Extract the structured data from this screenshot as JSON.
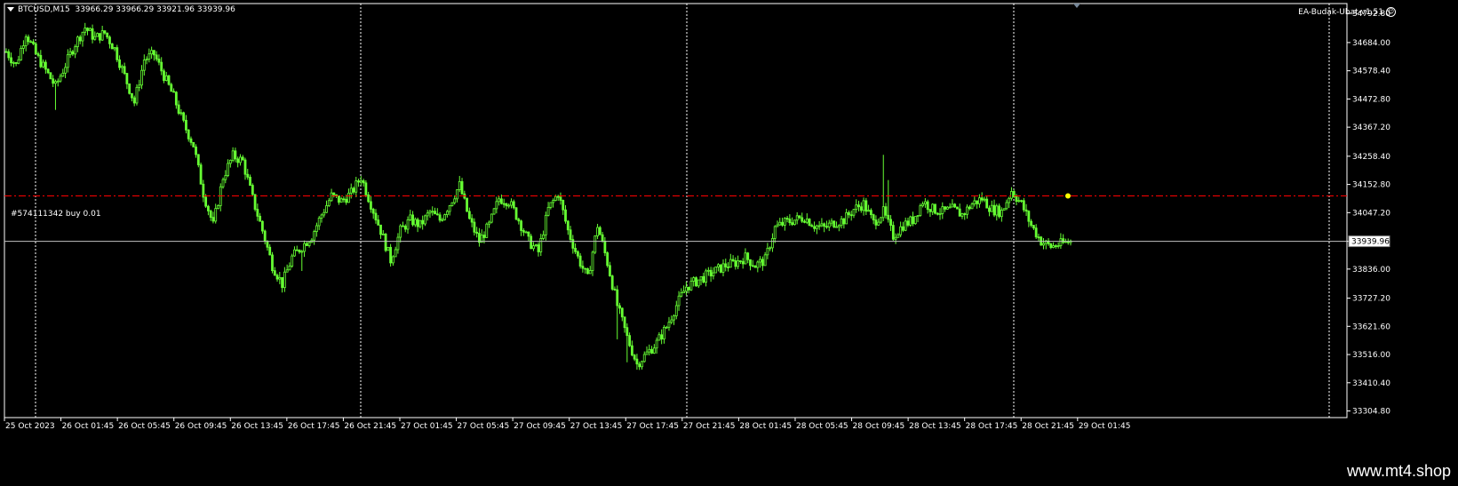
{
  "chart_header": {
    "symbol_timeframe": "BTCUSD,M15",
    "ohlc": "33966.29 33966.29 33921.96 33939.96"
  },
  "expert_advisor": {
    "name": "EA-Budak-Ubat-v1.51",
    "icon": "smiley-icon"
  },
  "order_line": {
    "label": "#574111342 buy 0.01",
    "price": 34110
  },
  "current_price": {
    "label": "33939.96",
    "value": 33939.96
  },
  "watermark": "www.mt4.shop",
  "colors": {
    "background": "#000000",
    "candles": "#66ff33",
    "grid": "#ffffff",
    "order_line": "#ff0000",
    "bid_line": "#c0c0c0",
    "text": "#ffffff"
  },
  "chart_data": {
    "type": "candlestick",
    "symbol": "BTCUSD",
    "timeframe": "M15",
    "y_ticks": [
      "34792.80",
      "34684.00",
      "34578.40",
      "34472.80",
      "34367.20",
      "34258.40",
      "34152.80",
      "34047.20",
      "33939.96",
      "33836.00",
      "33727.20",
      "33621.60",
      "33516.00",
      "33410.40",
      "33304.80"
    ],
    "ylim": [
      33280,
      34830
    ],
    "x_ticks": [
      "25 Oct 2023",
      "26 Oct 01:45",
      "26 Oct 05:45",
      "26 Oct 09:45",
      "26 Oct 13:45",
      "26 Oct 17:45",
      "26 Oct 21:45",
      "27 Oct 01:45",
      "27 Oct 05:45",
      "27 Oct 09:45",
      "27 Oct 13:45",
      "27 Oct 17:45",
      "27 Oct 21:45",
      "28 Oct 01:45",
      "28 Oct 05:45",
      "28 Oct 09:45",
      "28 Oct 13:45",
      "28 Oct 17:45",
      "28 Oct 21:45",
      "29 Oct 01:45"
    ],
    "day_separators": [
      "26 Oct 00:00",
      "27 Oct 00:00",
      "28 Oct 00:00",
      "29 Oct 00:00"
    ],
    "close_path": [
      [
        0,
        34650
      ],
      [
        4,
        34600
      ],
      [
        8,
        34720
      ],
      [
        12,
        34640
      ],
      [
        16,
        34580
      ],
      [
        20,
        34520
      ],
      [
        24,
        34600
      ],
      [
        28,
        34680
      ],
      [
        32,
        34740
      ],
      [
        36,
        34700
      ],
      [
        40,
        34720
      ],
      [
        44,
        34660
      ],
      [
        48,
        34560
      ],
      [
        52,
        34460
      ],
      [
        56,
        34620
      ],
      [
        60,
        34640
      ],
      [
        64,
        34560
      ],
      [
        68,
        34480
      ],
      [
        72,
        34380
      ],
      [
        76,
        34300
      ],
      [
        80,
        34120
      ],
      [
        84,
        34000
      ],
      [
        88,
        34180
      ],
      [
        92,
        34260
      ],
      [
        96,
        34240
      ],
      [
        100,
        34100
      ],
      [
        104,
        33980
      ],
      [
        108,
        33850
      ],
      [
        112,
        33780
      ],
      [
        116,
        33880
      ],
      [
        120,
        33920
      ],
      [
        124,
        33960
      ],
      [
        128,
        34040
      ],
      [
        132,
        34110
      ],
      [
        136,
        34090
      ],
      [
        140,
        34120
      ],
      [
        144,
        34180
      ],
      [
        148,
        34080
      ],
      [
        152,
        33980
      ],
      [
        156,
        33870
      ],
      [
        160,
        33980
      ],
      [
        164,
        34020
      ],
      [
        168,
        34000
      ],
      [
        172,
        34050
      ],
      [
        176,
        34020
      ],
      [
        180,
        34080
      ],
      [
        184,
        34150
      ],
      [
        188,
        34020
      ],
      [
        192,
        33940
      ],
      [
        196,
        34000
      ],
      [
        200,
        34100
      ],
      [
        204,
        34090
      ],
      [
        208,
        34020
      ],
      [
        212,
        33940
      ],
      [
        216,
        33900
      ],
      [
        220,
        34060
      ],
      [
        224,
        34120
      ],
      [
        228,
        33980
      ],
      [
        232,
        33880
      ],
      [
        236,
        33800
      ],
      [
        240,
        34000
      ],
      [
        244,
        33860
      ],
      [
        248,
        33700
      ],
      [
        252,
        33580
      ],
      [
        256,
        33480
      ],
      [
        260,
        33520
      ],
      [
        264,
        33560
      ],
      [
        268,
        33620
      ],
      [
        272,
        33700
      ],
      [
        276,
        33770
      ],
      [
        280,
        33790
      ],
      [
        284,
        33810
      ],
      [
        288,
        33830
      ],
      [
        292,
        33850
      ],
      [
        296,
        33860
      ],
      [
        300,
        33880
      ],
      [
        304,
        33850
      ],
      [
        308,
        33870
      ],
      [
        312,
        33990
      ],
      [
        316,
        34010
      ],
      [
        320,
        34020
      ],
      [
        324,
        34030
      ],
      [
        328,
        34000
      ],
      [
        332,
        33990
      ],
      [
        336,
        34010
      ],
      [
        340,
        34020
      ],
      [
        344,
        34060
      ],
      [
        348,
        34080
      ],
      [
        352,
        34010
      ],
      [
        356,
        34050
      ],
      [
        360,
        33960
      ],
      [
        364,
        34000
      ],
      [
        368,
        34020
      ],
      [
        372,
        34090
      ],
      [
        376,
        34060
      ],
      [
        380,
        34050
      ],
      [
        384,
        34060
      ],
      [
        388,
        34040
      ],
      [
        392,
        34080
      ],
      [
        396,
        34100
      ],
      [
        400,
        34060
      ],
      [
        404,
        34050
      ],
      [
        408,
        34130
      ],
      [
        412,
        34080
      ],
      [
        416,
        34000
      ],
      [
        420,
        33940
      ],
      [
        424,
        33920
      ],
      [
        428,
        33930
      ],
      [
        432,
        33940
      ]
    ]
  }
}
